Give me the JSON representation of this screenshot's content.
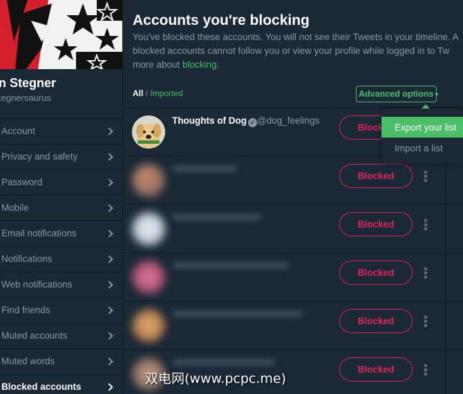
{
  "profile": {
    "name": "n Stegner",
    "handle": "tegnersaurus"
  },
  "nav": [
    {
      "label": "Account"
    },
    {
      "label": "Privacy and safety"
    },
    {
      "label": "Password"
    },
    {
      "label": "Mobile"
    },
    {
      "label": "Email notifications"
    },
    {
      "label": "Notifications"
    },
    {
      "label": "Web notifications"
    },
    {
      "label": "Find friends"
    },
    {
      "label": "Muted accounts"
    },
    {
      "label": "Muted words"
    },
    {
      "label": "Blocked accounts"
    }
  ],
  "main": {
    "title": "Accounts you're blocking",
    "desc_line1": "You've blocked these accounts. You will not see their Tweets in your timeline. A",
    "desc_line2": "blocked accounts cannot follow you or view your profile while logged in to Tw",
    "desc_line3_prefix": "more about ",
    "desc_link": "blocking.",
    "filter_all": "All",
    "filter_sep": " / ",
    "filter_imported": "Imported",
    "advanced_options": "Advanced options"
  },
  "accounts": [
    {
      "name": "Thoughts of Dog",
      "handle": "@dog_feelings",
      "button": "Blocked"
    },
    {
      "button": "Blocked"
    },
    {
      "button": "Blocked"
    },
    {
      "button": "Blocked"
    },
    {
      "button": "Blocked"
    },
    {
      "button": "Blocked"
    }
  ],
  "dropdown": {
    "export": "Export your list",
    "import": "Import a list"
  },
  "watermark": "双电网(www.pcpc.me)",
  "colors": {
    "accent_green": "#4cbe6a",
    "blocked_red": "#e0245e",
    "panel": "#1b2836"
  }
}
